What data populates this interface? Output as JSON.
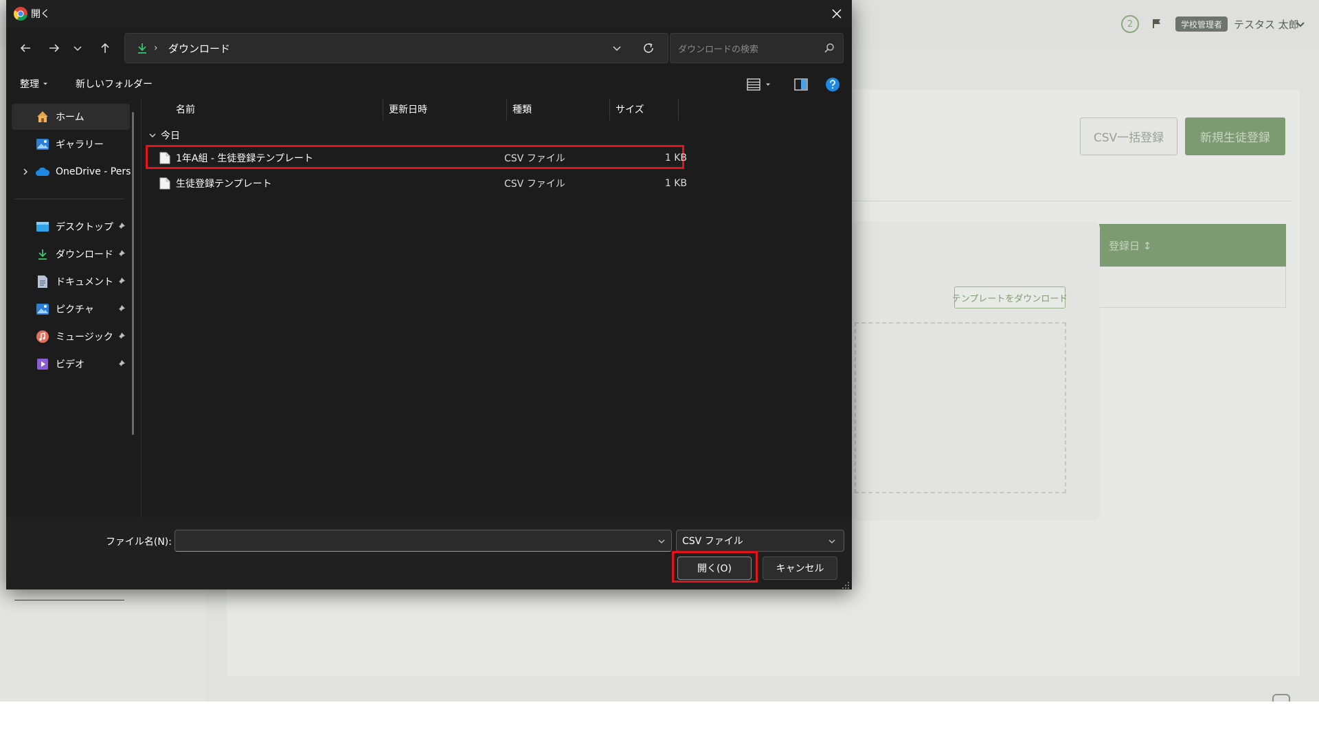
{
  "background_app": {
    "notification_count": "2",
    "role_badge": "学校管理者",
    "user_name": "テスタス 太郎",
    "csv_bulk_button": "CSV一括登録",
    "new_student_button": "新規生徒登録",
    "table_header_registered": "登録日 ↕",
    "template_download_button": "テンプレートをダウンロード"
  },
  "dialog": {
    "title": "開く",
    "address": {
      "separator": "›",
      "current_folder": "ダウンロード"
    },
    "search": {
      "placeholder": "ダウンロードの検索"
    },
    "command_bar": {
      "organize": "整理",
      "new_folder": "新しいフォルダー"
    },
    "nav_pane": {
      "items": [
        {
          "label": "ホーム",
          "icon": "home-icon"
        },
        {
          "label": "ギャラリー",
          "icon": "gallery-icon"
        },
        {
          "label": "OneDrive - Pers",
          "icon": "onedrive-cloud-icon"
        },
        {
          "label": "デスクトップ",
          "icon": "desktop-icon",
          "pinned": true
        },
        {
          "label": "ダウンロード",
          "icon": "download-icon",
          "pinned": true
        },
        {
          "label": "ドキュメント",
          "icon": "document-icon",
          "pinned": true
        },
        {
          "label": "ピクチャ",
          "icon": "pictures-icon",
          "pinned": true
        },
        {
          "label": "ミュージック",
          "icon": "music-icon",
          "pinned": true
        },
        {
          "label": "ビデオ",
          "icon": "video-icon",
          "pinned": true
        }
      ]
    },
    "columns": {
      "name": "名前",
      "modified": "更新日時",
      "type": "種類",
      "size": "サイズ"
    },
    "group": "今日",
    "files": [
      {
        "name": "1年A組 - 生徒登録テンプレート",
        "type": "CSV ファイル",
        "size": "1 KB",
        "highlighted": true
      },
      {
        "name": "生徒登録テンプレート",
        "type": "CSV ファイル",
        "size": "1 KB",
        "highlighted": false
      }
    ],
    "footer": {
      "filename_label": "ファイル名(N):",
      "filename_value": "",
      "filetype": "CSV ファイル",
      "open_button": "開く(O)",
      "cancel_button": "キャンセル"
    }
  },
  "colors": {
    "highlight": "#e3131b",
    "dialog_bg": "#1c1c1c",
    "accent_green": "#7c9b71",
    "help_blue": "#1e88e5"
  }
}
